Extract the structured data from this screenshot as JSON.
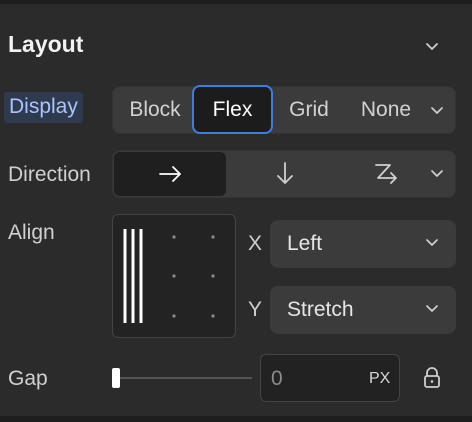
{
  "header": {
    "title": "Layout",
    "chevron_icon": "chevron-down-icon"
  },
  "display": {
    "label": "Display",
    "options": [
      "Block",
      "Flex",
      "Grid",
      "None"
    ],
    "selected": "Flex",
    "accent_color": "#3f7de0",
    "label_highlight_color": "#a9c4ff"
  },
  "direction": {
    "label": "Direction",
    "options": [
      "arrow-right-icon",
      "arrow-down-icon",
      "wrap-icon"
    ],
    "selected": "arrow-right-icon"
  },
  "align": {
    "label": "Align",
    "x_axis": "X",
    "x_value": "Left",
    "y_axis": "Y",
    "y_value": "Stretch"
  },
  "gap": {
    "label": "Gap",
    "value_placeholder": "0",
    "unit": "PX",
    "slider_value": 0,
    "lock_icon": "lock-icon"
  }
}
